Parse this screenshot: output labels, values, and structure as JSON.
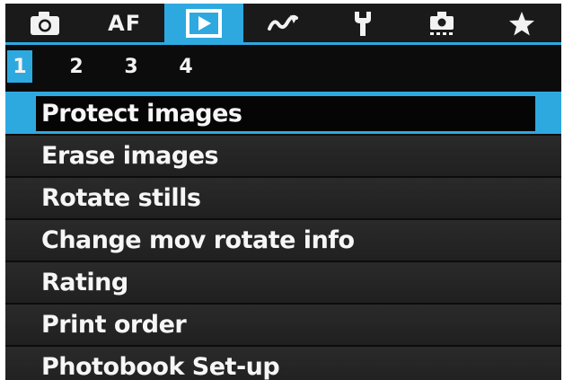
{
  "tabs": [
    {
      "icon": "camera-icon",
      "label": ""
    },
    {
      "icon": "af-icon",
      "label": "AF"
    },
    {
      "icon": "playback-icon",
      "label": "",
      "active": true
    },
    {
      "icon": "wireless-icon",
      "label": ""
    },
    {
      "icon": "wrench-icon",
      "label": ""
    },
    {
      "icon": "custom-functions-icon",
      "label": ""
    },
    {
      "icon": "star-icon",
      "label": ""
    }
  ],
  "pages": [
    "1",
    "2",
    "3",
    "4"
  ],
  "active_page": "1",
  "menu": {
    "items": [
      "Protect images",
      "Erase images",
      "Rotate stills",
      "Change mov rotate info",
      "Rating",
      "Print order",
      "Photobook Set-up"
    ],
    "selected_index": 0
  },
  "colors": {
    "accent": "#2ea9e0",
    "background": "#0c0c0c",
    "item_background": "#262626",
    "text": "#f6f6f6"
  }
}
